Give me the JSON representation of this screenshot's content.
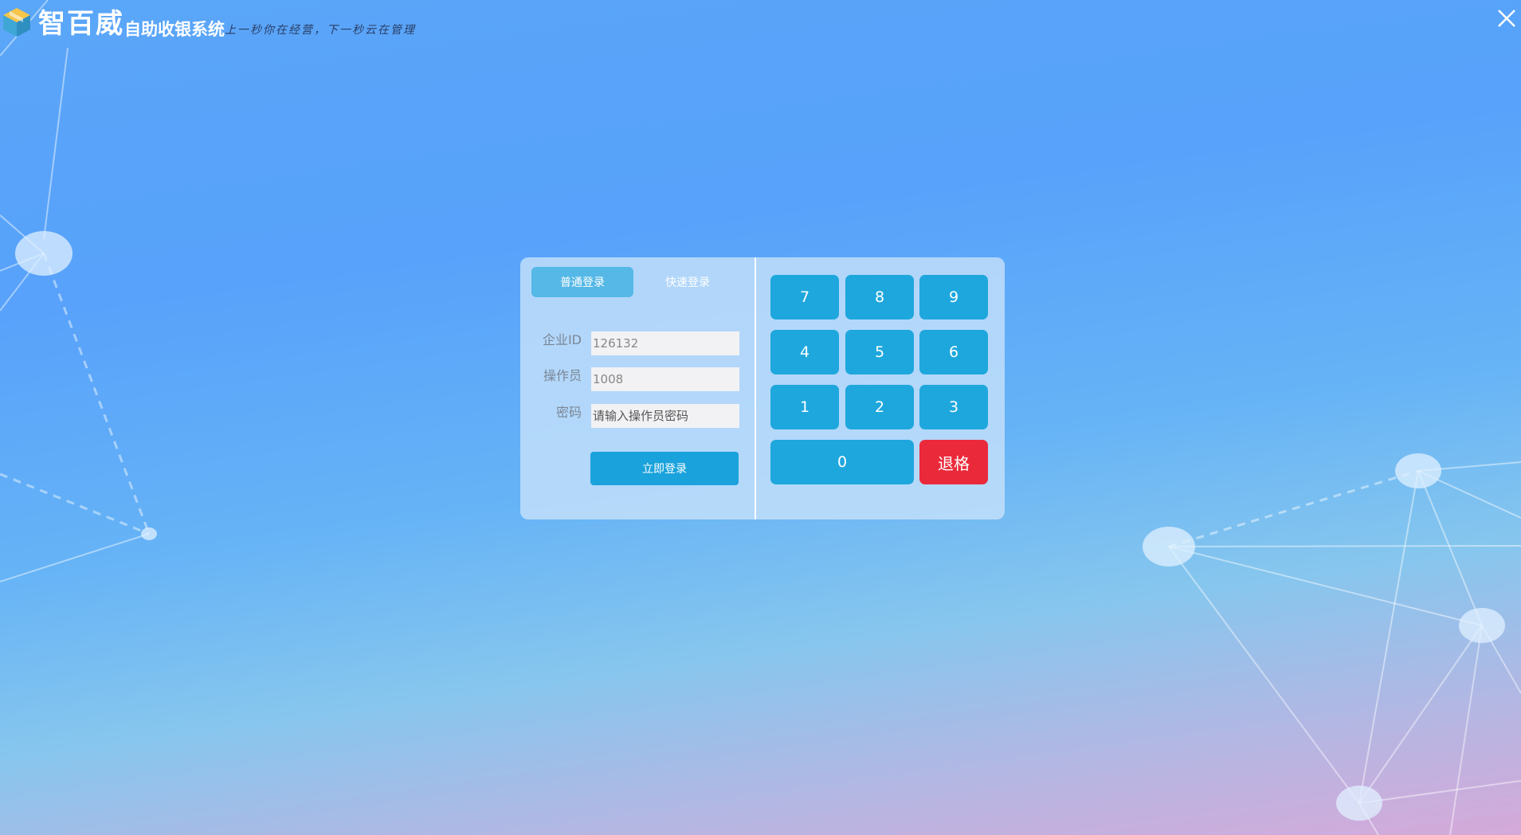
{
  "header": {
    "brand_name": "智百威",
    "brand_sub": "自助收银系统",
    "slogan": "上一秒你在经营，下一秒云在管理"
  },
  "login": {
    "tabs": [
      {
        "label": "普通登录",
        "active": true
      },
      {
        "label": "快速登录",
        "active": false
      }
    ],
    "fields": {
      "company_id": {
        "label": "企业ID",
        "value": "126132"
      },
      "operator": {
        "label": "操作员",
        "value": "1008"
      },
      "password": {
        "label": "密码",
        "placeholder": "请输入操作员密码"
      }
    },
    "submit_label": "立即登录"
  },
  "keypad": {
    "keys": [
      "7",
      "8",
      "9",
      "4",
      "5",
      "6",
      "1",
      "2",
      "3",
      "0"
    ],
    "backspace_label": "退格"
  },
  "colors": {
    "accent": "#1ea7dd",
    "tab_active": "#55b8e6",
    "danger": "#ea2a3b"
  }
}
